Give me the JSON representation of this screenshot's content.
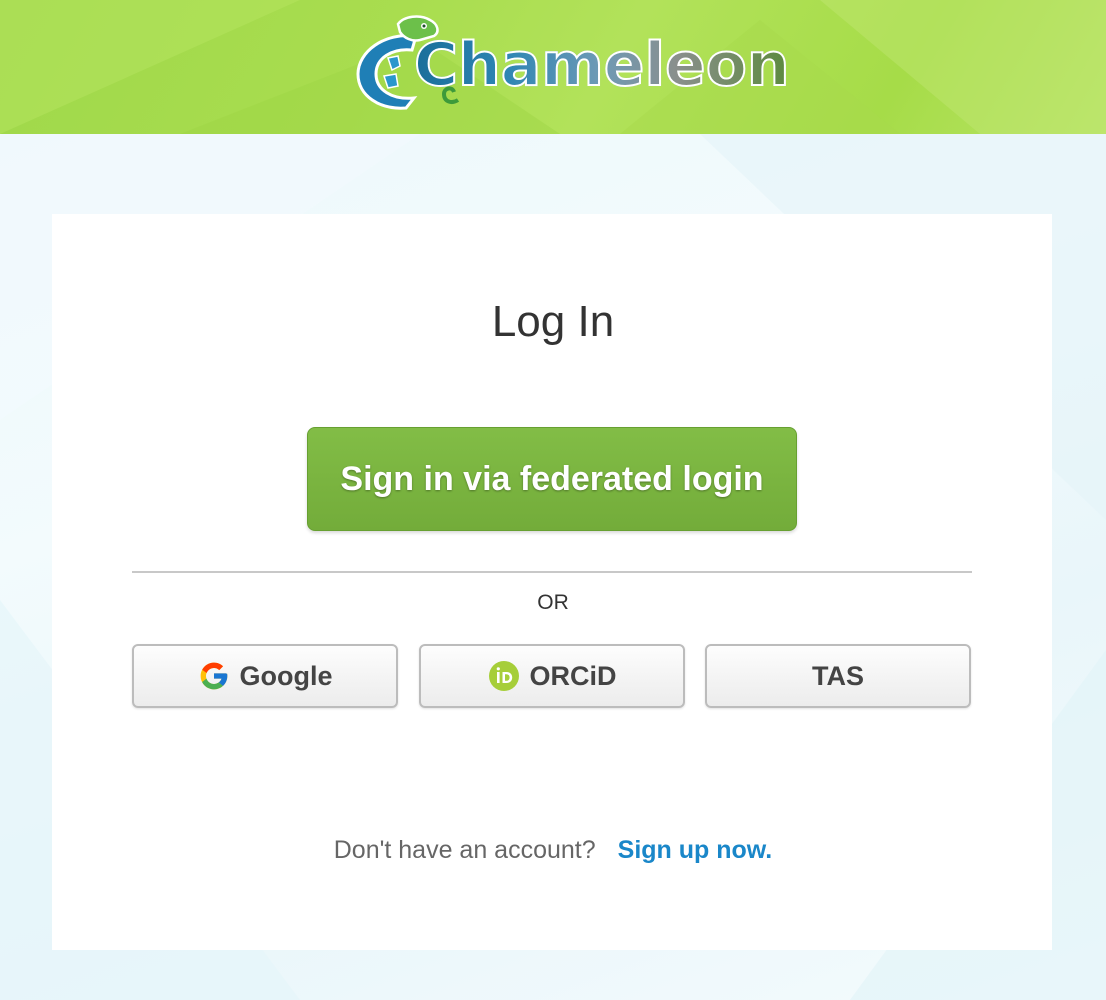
{
  "brand": {
    "logo_text": "Chameleon",
    "header_color": "#a9dd4f"
  },
  "login": {
    "title": "Log In",
    "federated_button_label": "Sign in via federated login",
    "or_label": "OR",
    "providers": [
      {
        "label": "Google",
        "icon": "google-icon"
      },
      {
        "label": "ORCiD",
        "icon": "orcid-icon"
      },
      {
        "label": "TAS",
        "icon": ""
      }
    ]
  },
  "signup": {
    "question": "Don't have an account?",
    "link_label": "Sign up now."
  },
  "colors": {
    "primary_green": "#79b440",
    "link_blue": "#1a87c9",
    "orcid_green": "#a6ce39"
  }
}
